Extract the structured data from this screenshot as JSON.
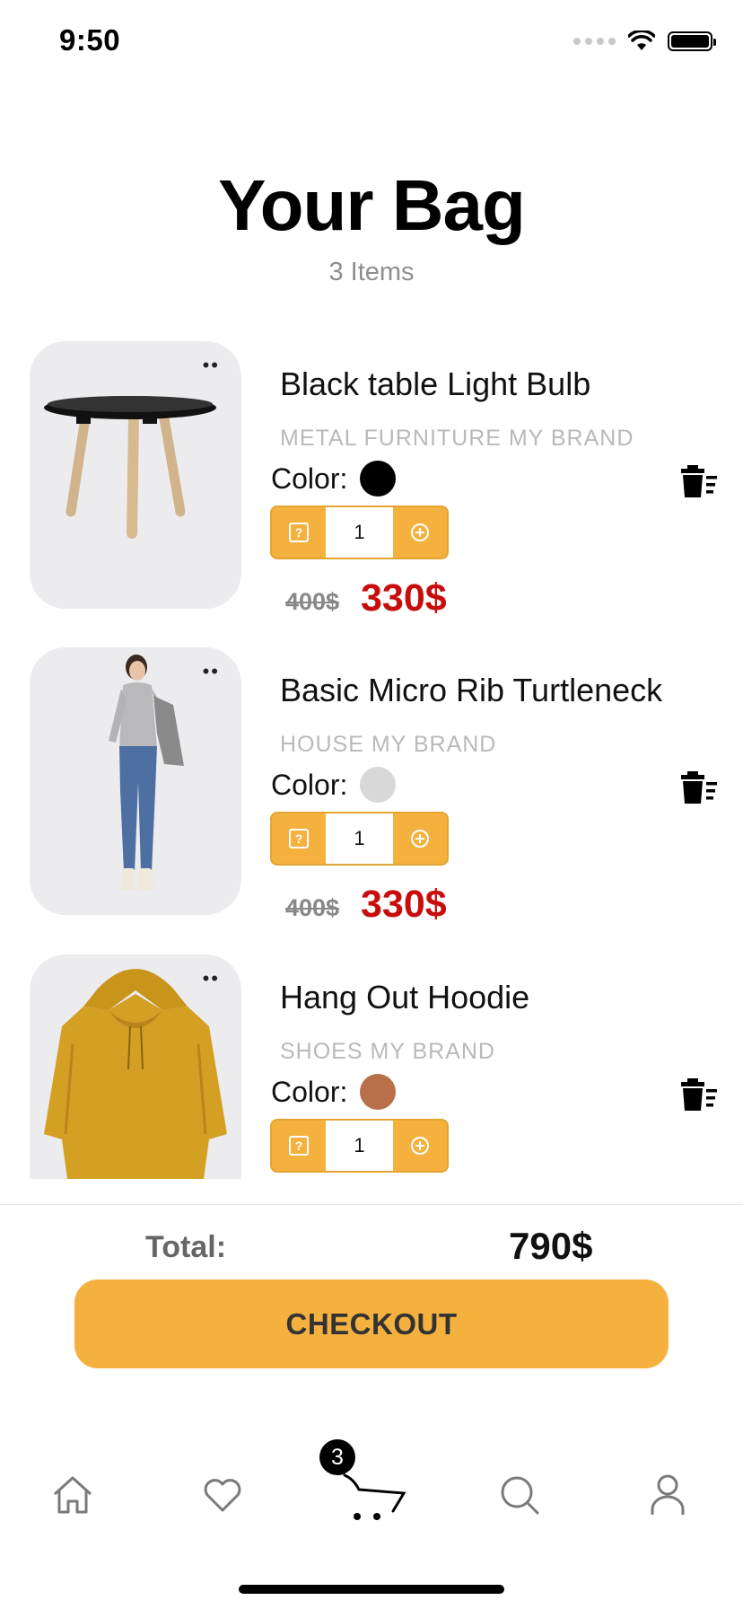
{
  "status_bar": {
    "time": "9:50"
  },
  "header": {
    "title": "Your Bag",
    "count": "3 Items"
  },
  "items": [
    {
      "name": "Black table Light Bulb",
      "subtitle": "METAL FURNITURE MY BRAND",
      "color_label": "Color:",
      "color": "#000000",
      "quantity": "1",
      "old_price": "400$",
      "price": "330$",
      "image": "side-table-icon"
    },
    {
      "name": "Basic Micro Rib Turtleneck",
      "subtitle": "HOUSE MY BRAND",
      "color_label": "Color:",
      "color": "#d8d8d8",
      "quantity": "1",
      "old_price": "400$",
      "price": "330$",
      "image": "woman-outfit-icon"
    },
    {
      "name": "Hang Out Hoodie",
      "subtitle": "SHOES MY BRAND",
      "color_label": "Color:",
      "color": "#b8704a",
      "quantity": "1",
      "image": "hoodie-icon"
    }
  ],
  "summary": {
    "total_label": "Total:",
    "total_value": "790$",
    "checkout_label": "CHECKOUT"
  },
  "tab_bar": {
    "cart_badge": "3",
    "tabs": [
      "home-icon",
      "heart-icon",
      "cart-icon",
      "search-icon",
      "profile-icon"
    ]
  },
  "colors": {
    "accent": "#f4b13e",
    "sale_price": "#c80d0d",
    "muted": "#b9b9b9"
  }
}
